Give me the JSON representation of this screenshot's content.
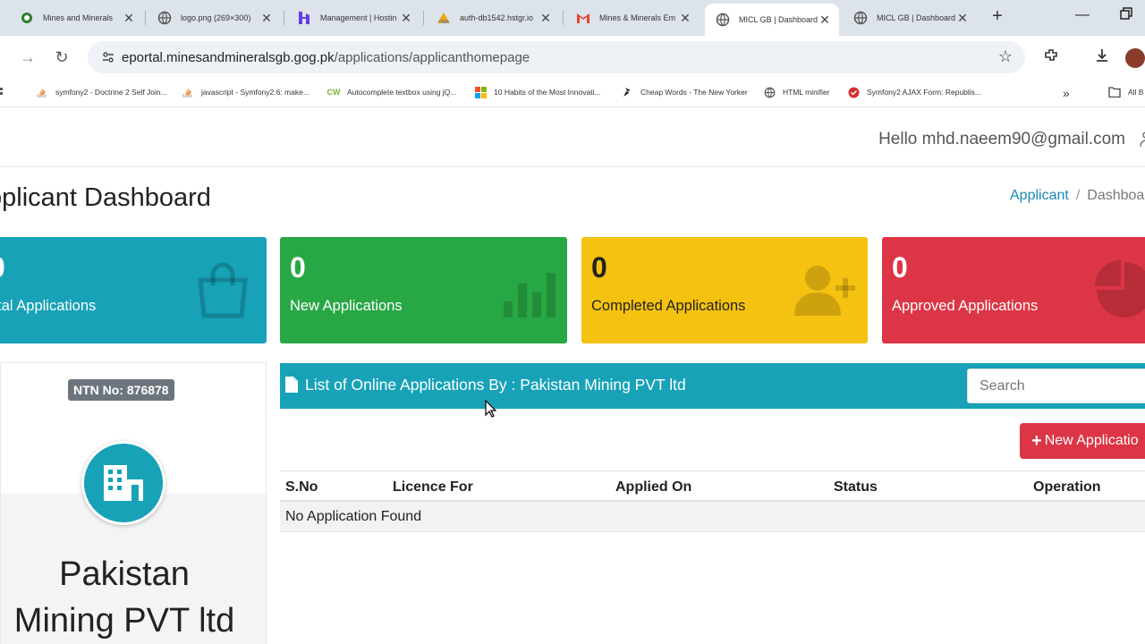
{
  "browser": {
    "tabs": [
      {
        "title": "Mines and Minerals",
        "icon": "emblem-icon",
        "active": false
      },
      {
        "title": "logo.png (269×300)",
        "icon": "globe-icon",
        "active": false
      },
      {
        "title": "Management | Hostin",
        "icon": "hostinger-icon",
        "active": false
      },
      {
        "title": "auth-db1542.hstgr.io",
        "icon": "pma-icon",
        "active": false
      },
      {
        "title": "Mines & Minerals Em",
        "icon": "gmail-icon",
        "active": false
      },
      {
        "title": "MICL GB | Dashboard",
        "icon": "globe-icon",
        "active": true
      },
      {
        "title": "MICL GB | Dashboard",
        "icon": "globe-icon",
        "active": false
      }
    ],
    "url_domain": "eportal.minesandmineralsgb.gog.pk",
    "url_path": "/applications/applicanthomepage",
    "bookmarks": [
      "symfony2 - Doctrine 2 Self Join...",
      "javascript - Symfony2.6: make...",
      "Autocomplete textbox using jQ...",
      "10 Habits of the Most Innovati...",
      "Cheap Words - The New Yorker",
      "HTML minifier",
      "Symfony2 AJAX Form: Republis..."
    ],
    "all_bookmarks_label": "All B"
  },
  "header": {
    "greeting": "Hello mhd.naeem90@gmail.com"
  },
  "page": {
    "title": "pplicant Dashboard",
    "breadcrumb": {
      "link": "Applicant",
      "separator": "/",
      "current": "Dashboa"
    }
  },
  "cards": [
    {
      "value": "0",
      "label": "otal Applications",
      "color": "#17a2b8",
      "icon": "shopping-bag-icon"
    },
    {
      "value": "0",
      "label": "New Applications",
      "color": "#28a745",
      "icon": "bar-chart-icon"
    },
    {
      "value": "0",
      "label": "Completed Applications",
      "color": "#f5c211",
      "icon": "user-plus-icon"
    },
    {
      "value": "0",
      "label": "Approved Applications",
      "color": "#dc3545",
      "icon": "pie-chart-icon"
    }
  ],
  "profile": {
    "ntn": "NTN No: 876878",
    "org_line1": "Pakistan",
    "org_line2": "Mining PVT ltd"
  },
  "applications": {
    "heading": "List of Online Applications By : Pakistan Mining PVT ltd",
    "search_placeholder": "Search",
    "new_button": "New Applicatio",
    "columns": [
      "S.No",
      "Licence For",
      "Applied On",
      "Status",
      "Operation"
    ],
    "empty_text": "No Application Found"
  }
}
